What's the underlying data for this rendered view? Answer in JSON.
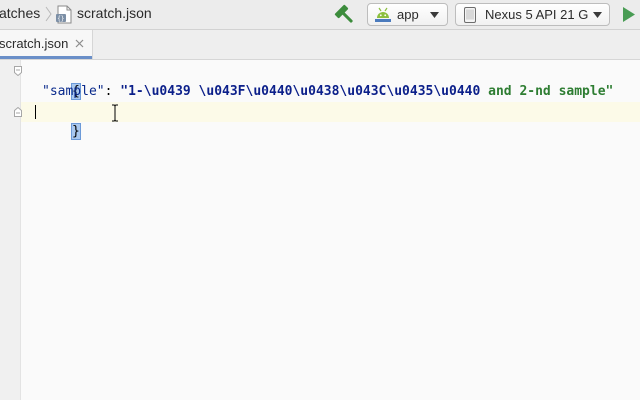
{
  "navbar": {
    "breadcrumb_prev": "atches",
    "breadcrumb_file": "scratch.json",
    "run_config": "app",
    "device": "Nexus 5 API 21 G"
  },
  "tabs": [
    {
      "label": "scratch.json"
    }
  ],
  "editor": {
    "lines": {
      "open_brace": "{",
      "key": "\"sample\"",
      "colon": ": ",
      "value_escaped": "\"1-\\u0439 \\u043F\\u0440\\u0438\\u043C\\u0435\\u0440",
      "value_plain": " and 2-nd sample\"",
      "close_brace": "}"
    }
  },
  "colors": {
    "key": "#0a2a8c",
    "escape_sequence": "#0b1f8a",
    "string_text": "#2e7d32",
    "brace_highlight": "#a9c8ef",
    "current_line": "#fcfae8",
    "tab_underline": "#6a8fc8",
    "build_icon": "#3c8c3c",
    "run_icon": "#499c54"
  },
  "icons": {
    "breadcrumb_separator": "chevron-right-icon",
    "file": "json-file-icon",
    "build": "hammer-icon",
    "run_config": "android-icon",
    "device": "phone-icon",
    "dropdown": "triangle-down-icon",
    "run": "play-icon",
    "tab_close": "close-icon",
    "fold": "fold-icon",
    "cursor": "text-cursor-icon"
  }
}
